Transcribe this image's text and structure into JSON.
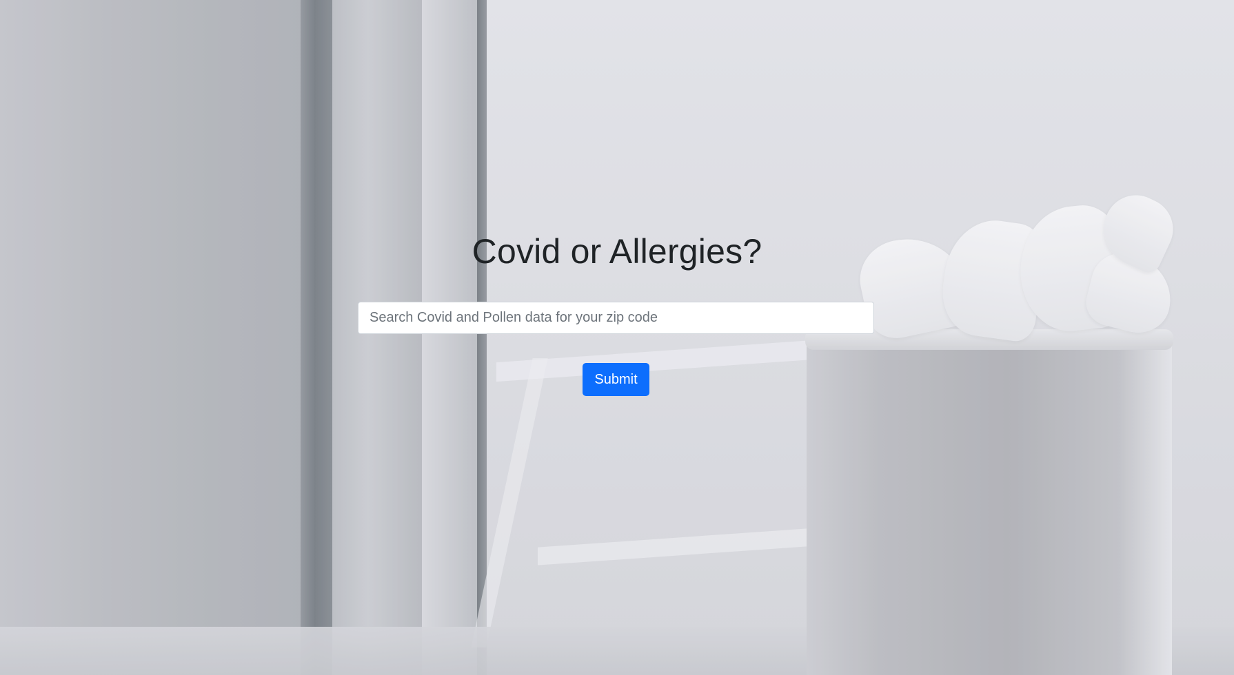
{
  "hero": {
    "title": "Covid or Allergies?"
  },
  "search": {
    "placeholder": "Search Covid and Pollen data for your zip code",
    "value": ""
  },
  "form": {
    "submit_label": "Submit"
  },
  "colors": {
    "primary": "#0d6efd",
    "title_text": "#1f2326"
  }
}
